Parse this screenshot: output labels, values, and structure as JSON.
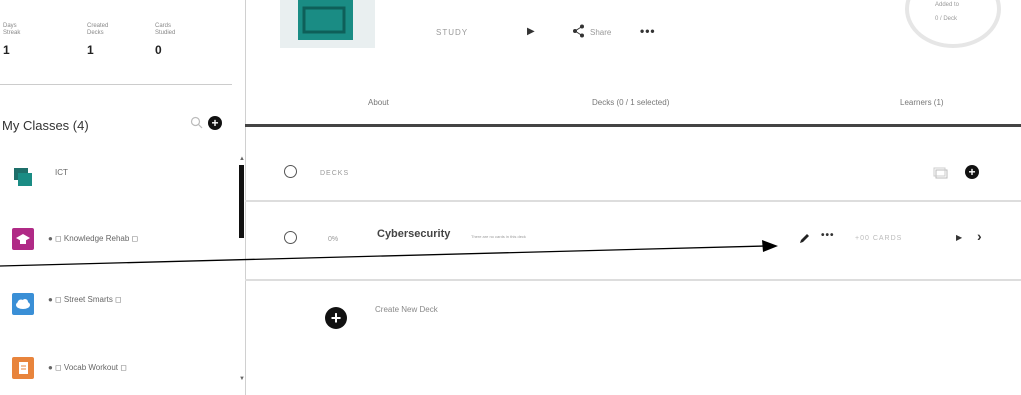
{
  "sidebar": {
    "stats": [
      {
        "label": "Days Streak",
        "value": "1"
      },
      {
        "label": "Created Decks",
        "value": "1"
      },
      {
        "label": "Cards Studied",
        "value": "0"
      }
    ],
    "classes_title": "My Classes (4)",
    "classes": [
      {
        "name": "ICT",
        "icon": "class-ict-icon",
        "color": "#1a8c84"
      },
      {
        "name": "Knowledge Rehab",
        "icon": "graduation-cap-icon",
        "color": "#b02a86"
      },
      {
        "name": "Street Smarts",
        "icon": "cloud-icon",
        "color": "#3a8fd6"
      },
      {
        "name": "Vocab Workout",
        "icon": "document-icon",
        "color": "#e8843c"
      }
    ]
  },
  "header": {
    "study_label": "STUDY",
    "share_label": "Share",
    "circle_line1": "Added to",
    "circle_line2": "0 / Deck"
  },
  "tabs": {
    "about": "About",
    "decks": "Decks (0 / 1 selected)",
    "learners": "Learners (1)"
  },
  "decks": {
    "header_label": "DECKS",
    "items": [
      {
        "percent": "0%",
        "title": "Cybersecurity",
        "subtitle": "There are no cards in this deck",
        "cards_label": "+00 CARDS"
      }
    ],
    "create_label": "Create New Deck"
  },
  "colors": {
    "accent_teal": "#1a8c84",
    "arrow": "#000000"
  }
}
